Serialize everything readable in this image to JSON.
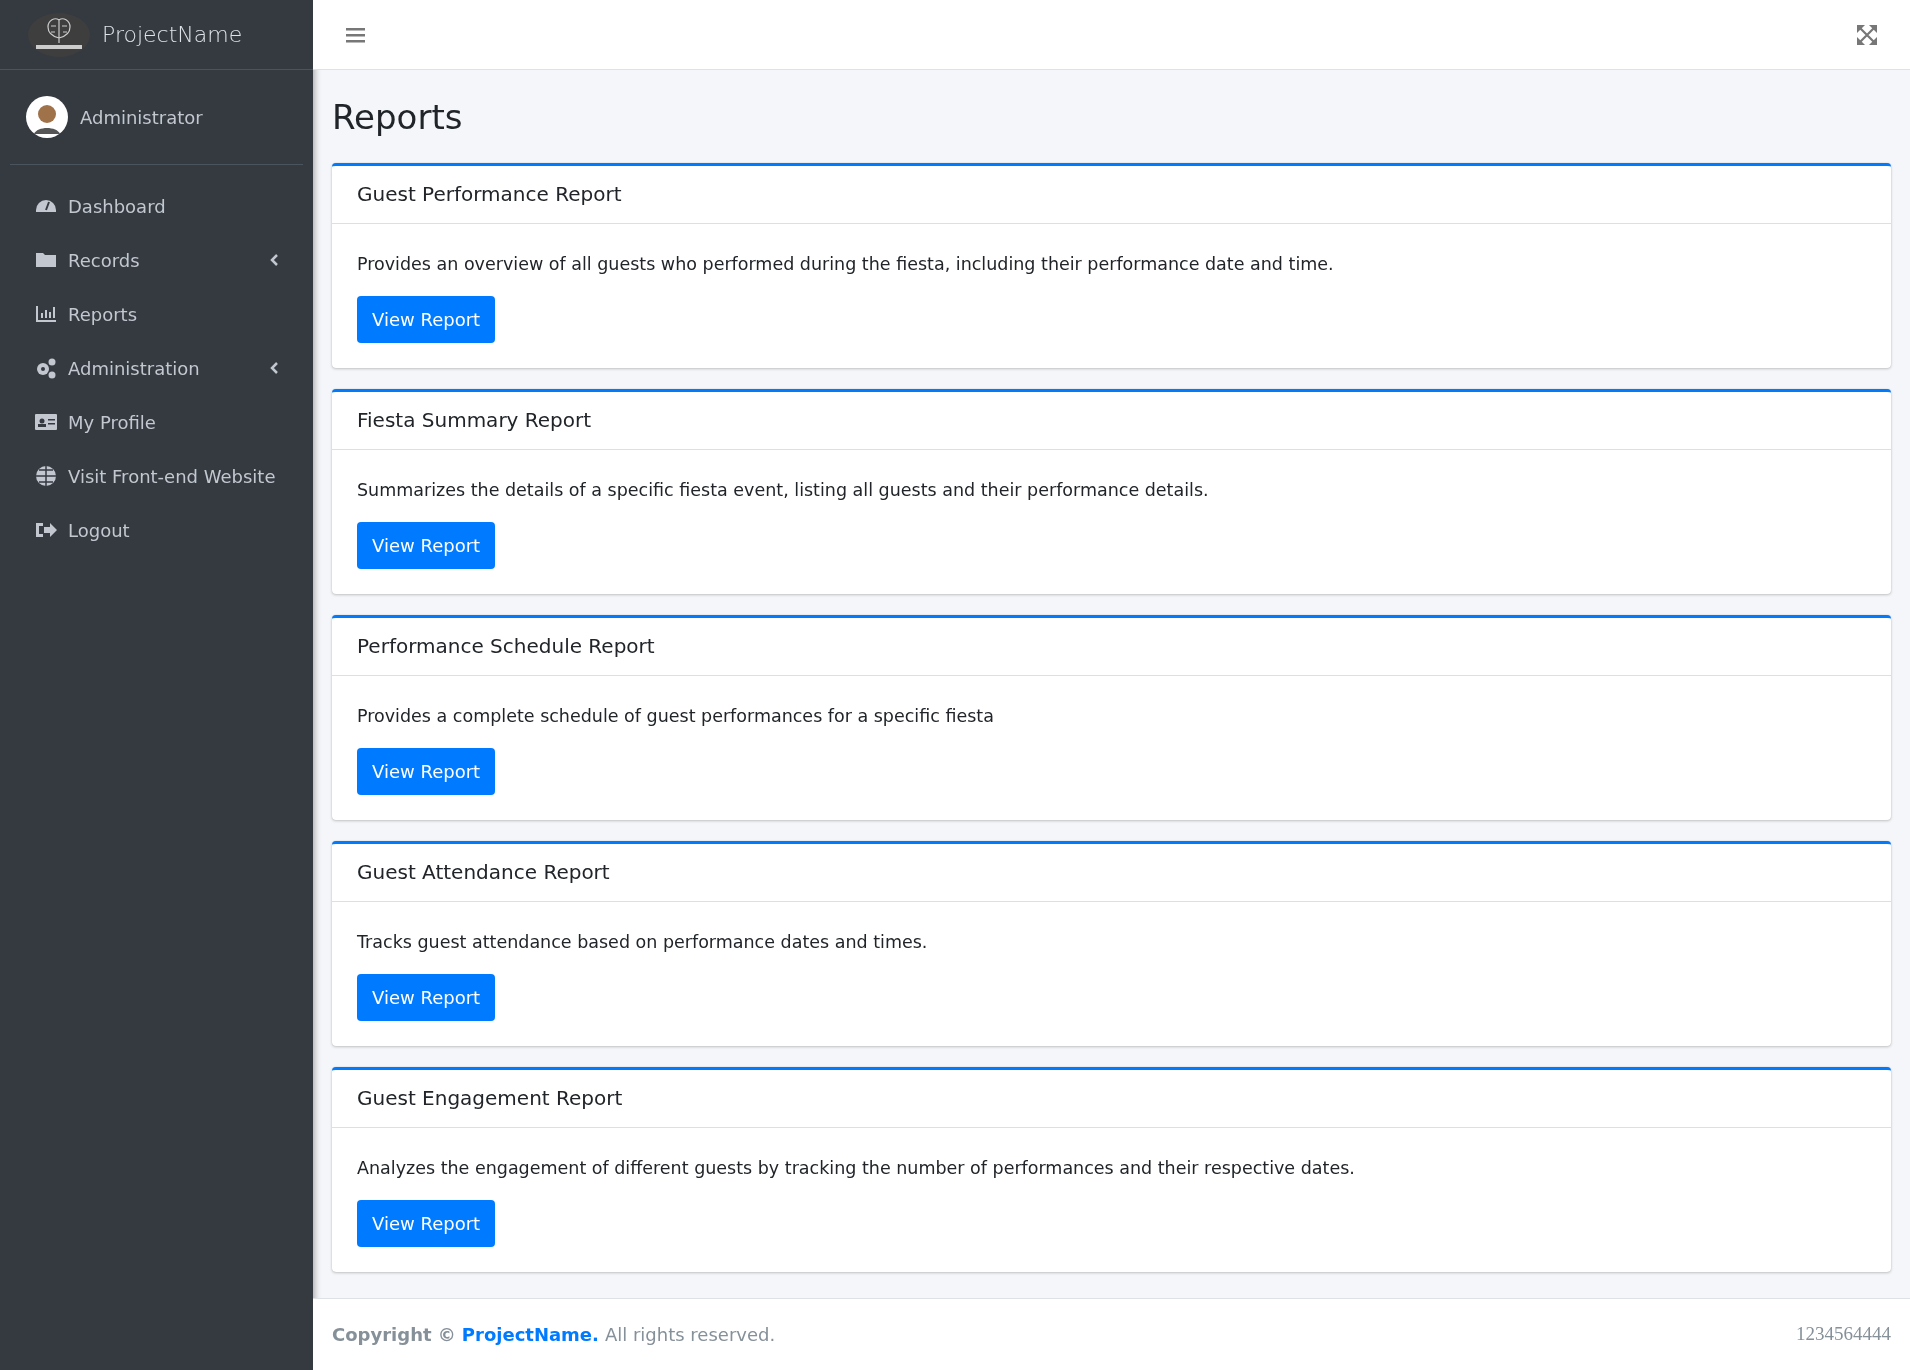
{
  "brand": {
    "name": "ProjectName"
  },
  "user": {
    "name": "Administrator"
  },
  "sidebar": {
    "items": [
      {
        "label": "Dashboard",
        "has_submenu": false
      },
      {
        "label": "Records",
        "has_submenu": true
      },
      {
        "label": "Reports",
        "has_submenu": false
      },
      {
        "label": "Administration",
        "has_submenu": true
      },
      {
        "label": "My Profile",
        "has_submenu": false
      },
      {
        "label": "Visit Front-end Website",
        "has_submenu": false
      },
      {
        "label": "Logout",
        "has_submenu": false
      }
    ]
  },
  "page_title": "Reports",
  "reports": [
    {
      "title": "Guest Performance Report",
      "description": "Provides an overview of all guests who performed during the fiesta, including their performance date and time.",
      "button": "View Report"
    },
    {
      "title": "Fiesta Summary Report",
      "description": "Summarizes the details of a specific fiesta event, listing all guests and their performance details.",
      "button": "View Report"
    },
    {
      "title": "Performance Schedule Report",
      "description": "Provides a complete schedule of guest performances for a specific fiesta",
      "button": "View Report"
    },
    {
      "title": "Guest Attendance Report",
      "description": "Tracks guest attendance based on performance dates and times.",
      "button": "View Report"
    },
    {
      "title": "Guest Engagement Report",
      "description": "Analyzes the engagement of different guests by tracking the number of performances and their respective dates.",
      "button": "View Report"
    }
  ],
  "footer": {
    "copyright": "Copyright ©",
    "link": "ProjectName.",
    "rest": "All rights reserved.",
    "version": "1234564444"
  }
}
